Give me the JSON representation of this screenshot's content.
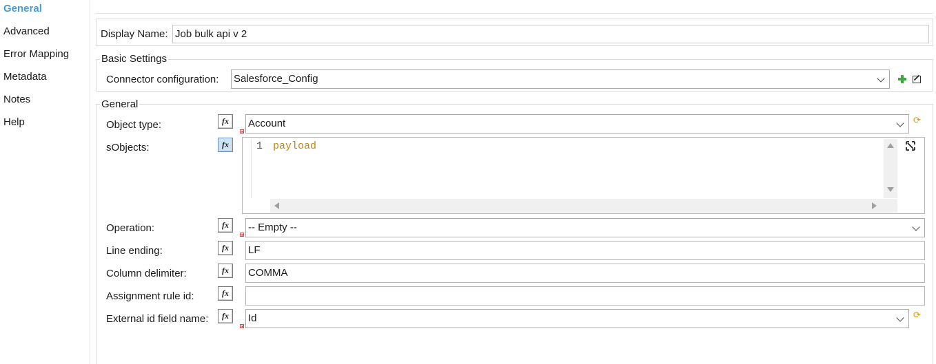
{
  "nav": {
    "items": [
      {
        "label": "General",
        "active": true
      },
      {
        "label": "Advanced"
      },
      {
        "label": "Error Mapping"
      },
      {
        "label": "Metadata"
      },
      {
        "label": "Notes"
      },
      {
        "label": "Help"
      }
    ]
  },
  "display_name": {
    "label": "Display Name:",
    "value": "Job bulk api v 2"
  },
  "basic_settings": {
    "title": "Basic Settings",
    "connector_label": "Connector configuration:",
    "connector_value": "Salesforce_Config"
  },
  "general": {
    "title": "General",
    "object_type": {
      "label": "Object type:",
      "value": "Account"
    },
    "sobjects": {
      "label": "sObjects:",
      "line_number": "1",
      "code": "payload"
    },
    "operation": {
      "label": "Operation:",
      "value": "-- Empty --"
    },
    "line_ending": {
      "label": "Line ending:",
      "value": "LF"
    },
    "column_delimiter": {
      "label": "Column delimiter:",
      "value": "COMMA"
    },
    "assignment_rule_id": {
      "label": "Assignment rule id:",
      "value": ""
    },
    "external_id_field_name": {
      "label": "External id field name:",
      "value": "Id"
    }
  },
  "fx_label": "fx",
  "icons": {
    "add": "add-icon",
    "edit": "edit-icon",
    "refresh": "refresh-metadata-icon",
    "expand": "expand-editor-icon",
    "required": "required-error-icon"
  },
  "colors": {
    "active_nav": "#4a9ccf",
    "code_keyword": "#c4840d",
    "add_green": "#3fa93f",
    "refresh_orange": "#d89512",
    "required_red": "#d22222"
  }
}
